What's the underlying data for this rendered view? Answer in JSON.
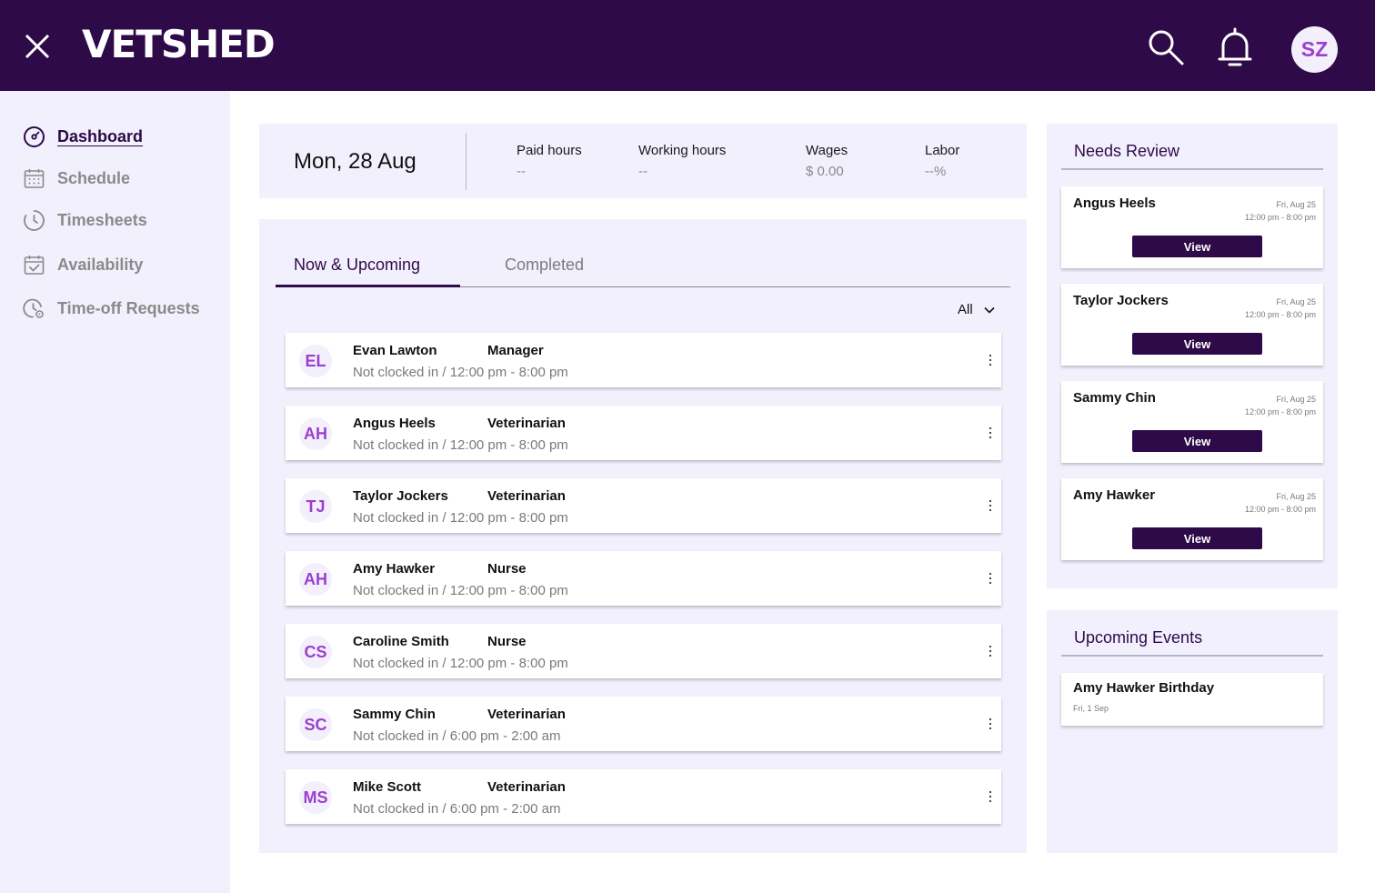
{
  "brand": "VETSHED",
  "user_initials": "SZ",
  "colors": {
    "primary": "#2e0a48",
    "accent": "#9b3fd1",
    "panel_bg": "#f2f0fd"
  },
  "nav": [
    {
      "label": "Dashboard",
      "icon": "dashboard-gauge-icon",
      "active": true
    },
    {
      "label": "Schedule",
      "icon": "calendar-grid-icon",
      "active": false
    },
    {
      "label": "Timesheets",
      "icon": "clock-history-icon",
      "active": false
    },
    {
      "label": "Availability",
      "icon": "calendar-check-icon",
      "active": false
    },
    {
      "label": "Time-off Requests",
      "icon": "clock-settings-icon",
      "active": false
    }
  ],
  "summary": {
    "date": "Mon, 28 Aug",
    "stats": [
      {
        "label": "Paid hours",
        "value": "--"
      },
      {
        "label": "Working hours",
        "value": "--"
      },
      {
        "label": "Wages",
        "value": "$ 0.00"
      },
      {
        "label": "Labor",
        "value": "--%"
      }
    ]
  },
  "tabs": {
    "active": "Now & Upcoming",
    "inactive": "Completed"
  },
  "filter": {
    "value": "All"
  },
  "shifts": [
    {
      "initials": "EL",
      "name": "Evan Lawton",
      "role": "Manager",
      "status": "Not clocked in / 12:00 pm - 8:00 pm"
    },
    {
      "initials": "AH",
      "name": "Angus Heels",
      "role": "Veterinarian",
      "status": "Not clocked in / 12:00 pm - 8:00 pm"
    },
    {
      "initials": "TJ",
      "name": "Taylor Jockers",
      "role": "Veterinarian",
      "status": "Not clocked in / 12:00 pm - 8:00 pm"
    },
    {
      "initials": "AH",
      "name": "Amy Hawker",
      "role": "Nurse",
      "status": "Not clocked in / 12:00 pm - 8:00 pm"
    },
    {
      "initials": "CS",
      "name": "Caroline Smith",
      "role": "Nurse",
      "status": "Not clocked in / 12:00 pm - 8:00 pm"
    },
    {
      "initials": "SC",
      "name": "Sammy Chin",
      "role": "Veterinarian",
      "status": "Not clocked in / 6:00 pm - 2:00 am"
    },
    {
      "initials": "MS",
      "name": "Mike Scott",
      "role": "Veterinarian",
      "status": "Not clocked in / 6:00 pm - 2:00 am"
    }
  ],
  "needs_review": {
    "title": "Needs Review",
    "items": [
      {
        "name": "Angus Heels",
        "date": "Fri, Aug 25",
        "time": "12:00 pm - 8:00 pm",
        "button": "View"
      },
      {
        "name": "Taylor Jockers",
        "date": "Fri, Aug 25",
        "time": "12:00 pm - 8:00 pm",
        "button": "View"
      },
      {
        "name": "Sammy Chin",
        "date": "Fri, Aug 25",
        "time": "12:00 pm - 8:00 pm",
        "button": "View"
      },
      {
        "name": "Amy Hawker",
        "date": "Fri, Aug 25",
        "time": "12:00 pm - 8:00 pm",
        "button": "View"
      }
    ]
  },
  "upcoming_events": {
    "title": "Upcoming Events",
    "items": [
      {
        "name": "Amy Hawker Birthday",
        "date": "Fri, 1 Sep"
      }
    ]
  }
}
